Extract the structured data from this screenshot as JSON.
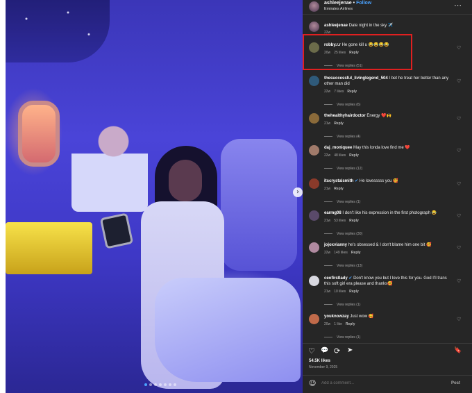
{
  "post": {
    "username": "ashleejenae",
    "separator": "•",
    "follow_label": "Follow",
    "subtitle": "Emirates Airlines",
    "caption_username": "ashleejenae",
    "caption_text": "Date night in the sky ✈️",
    "caption_age": "22w"
  },
  "comments": [
    {
      "username": "robby.r.r",
      "text": "He gone kill u 😂😂😂😂",
      "age": "20w",
      "likes": "25 likes",
      "reply": "Reply",
      "views": "View replies (51)",
      "avatar_color": "#6b6b4a"
    },
    {
      "username": "thesuccessful_livinglegend_504",
      "text": "I bet he treat her better than any other man did",
      "age": "22w",
      "likes": "7 likes",
      "reply": "Reply",
      "views": "View replies (6)",
      "avatar_color": "#2f5a7a"
    },
    {
      "username": "thehealthyhairdoctor",
      "text": "Energy ❤️🙌",
      "age": "21w",
      "likes": "",
      "reply": "Reply",
      "views": "View replies (4)",
      "avatar_color": "#8a6a3a"
    },
    {
      "username": "daj_moniquee",
      "text": "May this londa love find me ❤️",
      "age": "22w",
      "likes": "48 likes",
      "reply": "Reply",
      "views": "View replies (12)",
      "avatar_color": "#a07a6a"
    },
    {
      "username": "itscrystalsmith",
      "text": "He lovesssss you 🥰",
      "age": "21w",
      "likes": "",
      "reply": "Reply",
      "views": "View replies (1)",
      "avatar_color": "#8a3a2a",
      "verified": true
    },
    {
      "username": "earmg08",
      "text": "I don't like his expression in the first photograph 😂",
      "age": "21w",
      "likes": "53 likes",
      "reply": "Reply",
      "views": "View replies (30)",
      "avatar_color": "#5a4a6a"
    },
    {
      "username": "jojoxvianny",
      "text": "he's obsessed & I don't blame him one bit 🥰",
      "age": "22w",
      "likes": "149 likes",
      "reply": "Reply",
      "views": "View replies (13)",
      "avatar_color": "#b08aa0"
    },
    {
      "username": "ceofirstlady",
      "text": "Don't know you but I love this for you. God I'll trans this soft girl era please and thanks🥰",
      "age": "21w",
      "likes": "10 likes",
      "reply": "Reply",
      "views": "View replies (1)",
      "avatar_color": "#d8d8e0",
      "verified": true
    },
    {
      "username": "youknowzay",
      "text": "Just wow 🥰",
      "age": "20w",
      "likes": "1 like",
      "reply": "Reply",
      "views": "View replies (1)",
      "avatar_color": "#c06a4a"
    }
  ],
  "footer": {
    "likes": "54.5K likes",
    "date": "November 9, 2025",
    "add_placeholder": "Add a comment...",
    "post_label": "Post"
  },
  "icons": {
    "more": "⋯",
    "heart": "♡",
    "comment": "💬",
    "repost": "⟳",
    "share": "➤",
    "save": "🔖",
    "emoji": "☺",
    "next": "›"
  }
}
